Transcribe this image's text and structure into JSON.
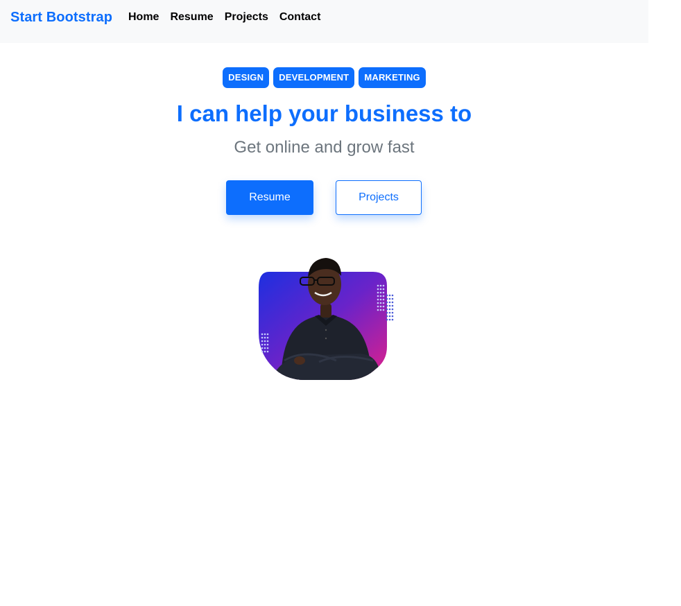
{
  "navbar": {
    "brand": "Start Bootstrap",
    "links": [
      "Home",
      "Resume",
      "Projects",
      "Contact"
    ]
  },
  "hero": {
    "badges": [
      "DESIGN",
      "DEVELOPMENT",
      "MARKETING"
    ],
    "headline": "I can help your business to",
    "subheadline": "Get online and grow fast",
    "primary_button": "Resume",
    "secondary_button": "Projects"
  },
  "profile_image": {
    "description_icon": "profile-photo"
  },
  "colors": {
    "primary": "#0d6efd",
    "muted": "#6c757d",
    "nav_bg": "#f8f9fa"
  }
}
